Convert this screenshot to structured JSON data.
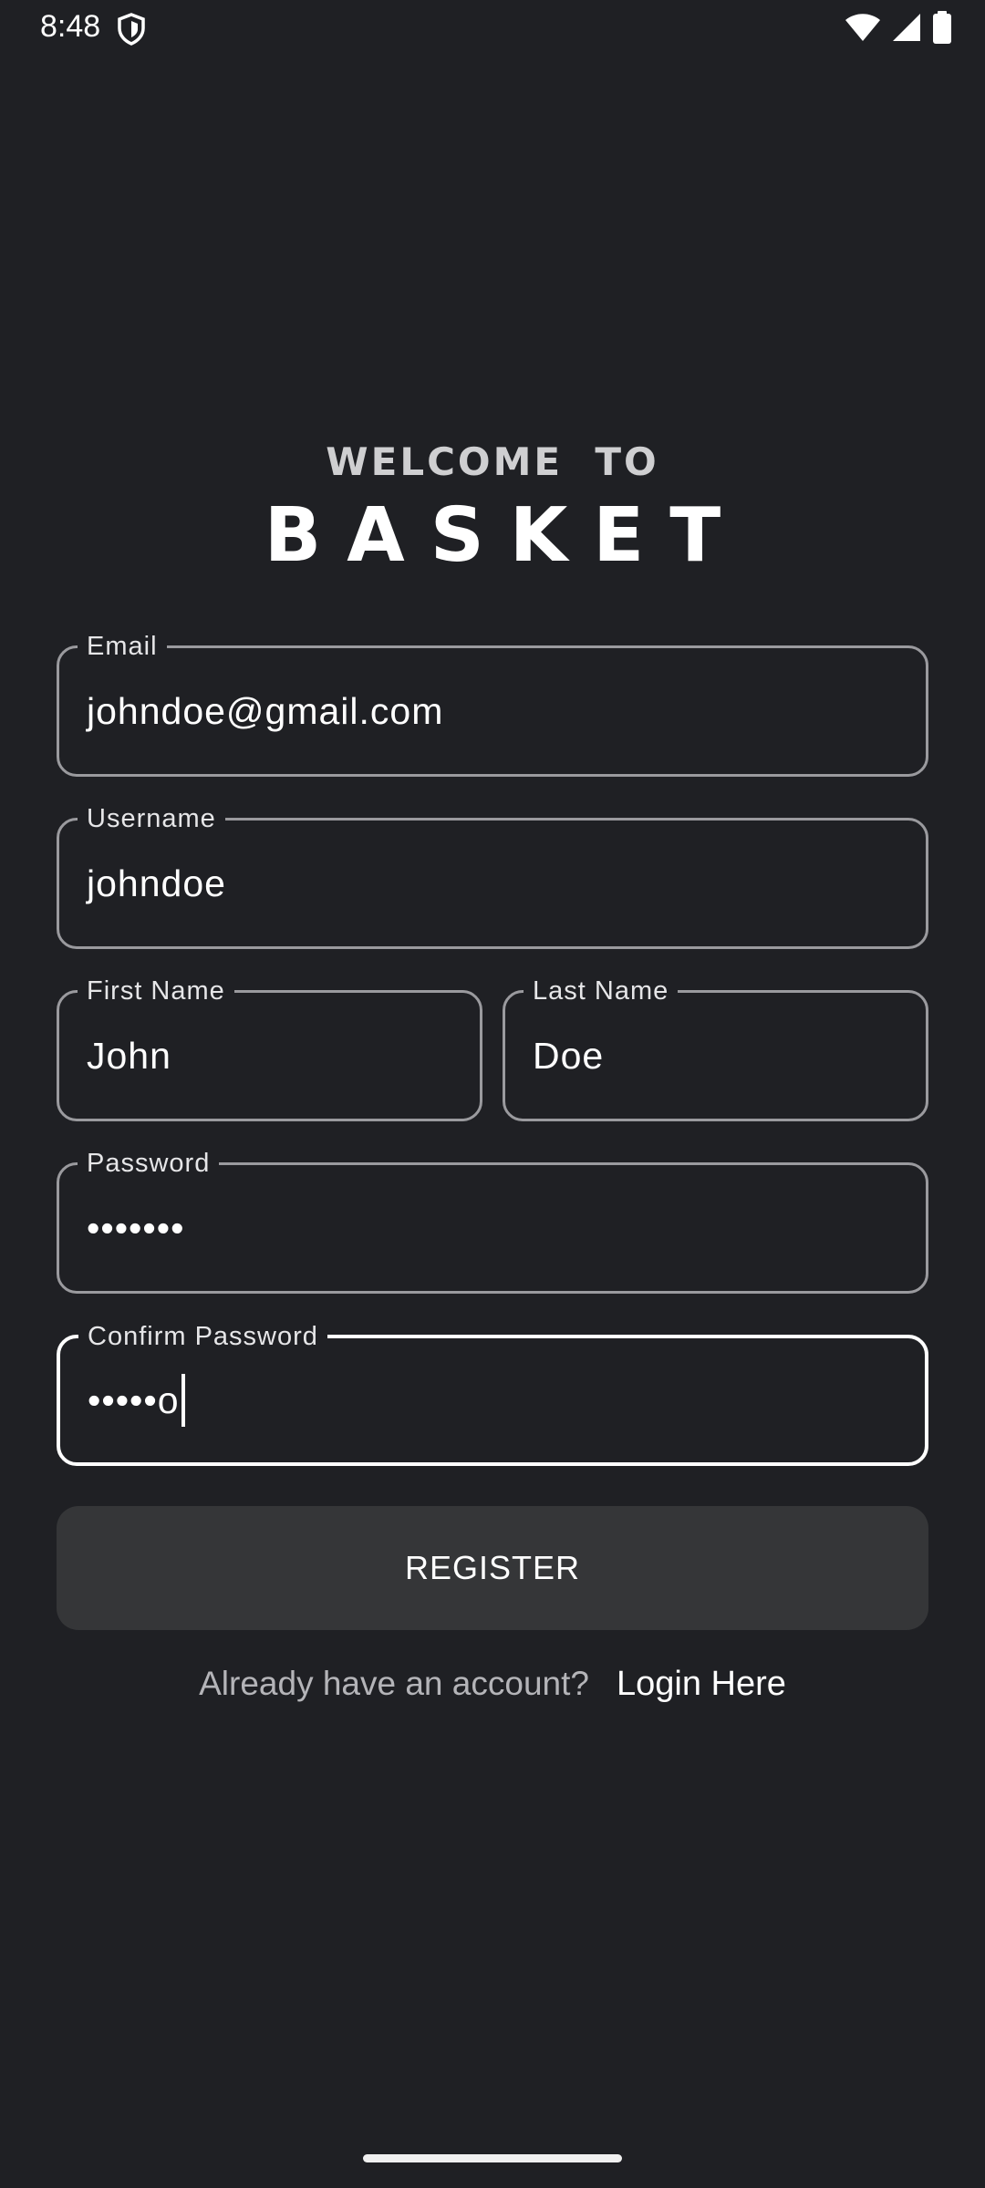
{
  "status_bar": {
    "time": "8:48",
    "icons": [
      "shield-icon",
      "wifi-icon",
      "signal-icon",
      "battery-icon"
    ]
  },
  "header": {
    "welcome": "WELCOME  TO",
    "brand": "BASKET"
  },
  "form": {
    "email": {
      "label": "Email",
      "value": "johndoe@gmail.com"
    },
    "username": {
      "label": "Username",
      "value": "johndoe"
    },
    "first_name": {
      "label": "First Name",
      "value": "John"
    },
    "last_name": {
      "label": "Last Name",
      "value": "Doe"
    },
    "password": {
      "label": "Password",
      "value": "•••••••"
    },
    "confirm_password": {
      "label": "Confirm Password",
      "value": "•••••o",
      "focused": true
    }
  },
  "actions": {
    "register_label": "REGISTER",
    "login_prompt": "Already have an account?",
    "login_link": "Login Here"
  },
  "colors": {
    "background": "#1f2024",
    "field_border": "#9a9a9e",
    "field_border_focused": "#ffffff",
    "button_background": "#353638",
    "muted_text": "#b4b4b8"
  }
}
